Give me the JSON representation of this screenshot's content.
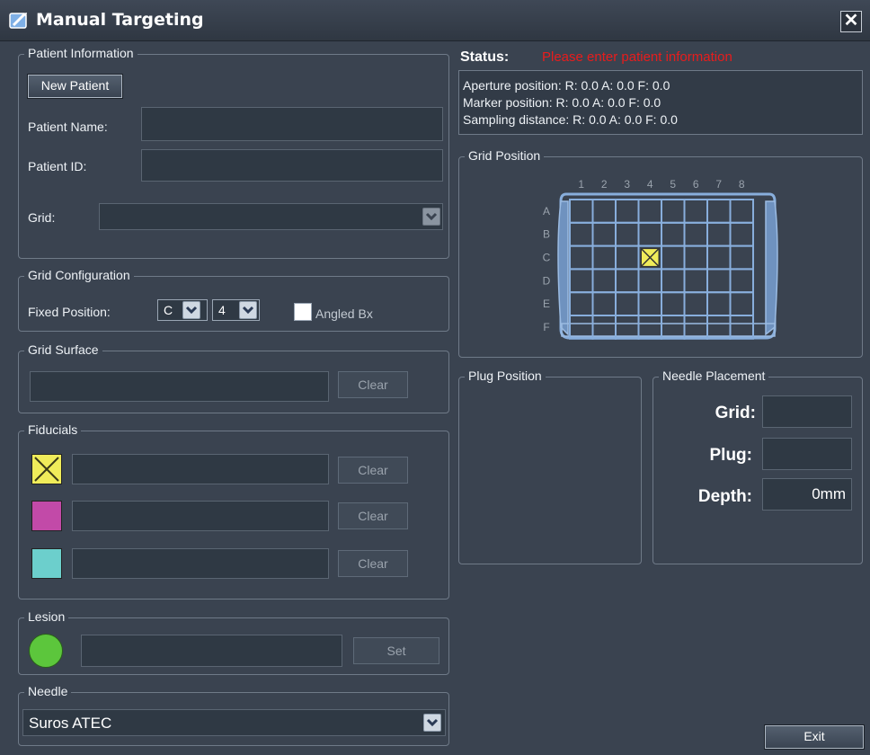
{
  "window": {
    "title": "Manual Targeting",
    "close_glyph": "✕"
  },
  "patient_info": {
    "legend": "Patient Information",
    "new_patient_label": "New Patient",
    "name_label": "Patient Name:",
    "name_value": "",
    "id_label": "Patient ID:",
    "id_value": "",
    "grid_label": "Grid:",
    "grid_value": ""
  },
  "grid_config": {
    "legend": "Grid Configuration",
    "fixed_position_label": "Fixed Position:",
    "row_value": "C",
    "col_value": "4",
    "angled_label": "Angled Bx",
    "angled_checked": false
  },
  "grid_surface": {
    "legend": "Grid Surface",
    "value": "",
    "clear_label": "Clear"
  },
  "fiducials": {
    "legend": "Fiducials",
    "items": [
      {
        "color": "#f0ec5a",
        "value": "",
        "clear_label": "Clear",
        "marked": true
      },
      {
        "color": "#c24aa8",
        "value": "",
        "clear_label": "Clear",
        "marked": false
      },
      {
        "color": "#6ccfcc",
        "value": "",
        "clear_label": "Clear",
        "marked": false
      }
    ]
  },
  "lesion": {
    "legend": "Lesion",
    "color": "#5cc63c",
    "value": "",
    "set_label": "Set"
  },
  "needle": {
    "legend": "Needle",
    "value": "Suros ATEC"
  },
  "status": {
    "label": "Status:",
    "message": "Please enter patient information",
    "lines": [
      "Aperture position: R: 0.0  A: 0.0  F: 0.0",
      "Marker position: R: 0.0  A: 0.0  F: 0.0",
      "Sampling distance: R: 0.0  A: 0.0  F: 0.0"
    ]
  },
  "grid_position": {
    "legend": "Grid Position",
    "columns": [
      "1",
      "2",
      "3",
      "4",
      "5",
      "6",
      "7",
      "8"
    ],
    "rows": [
      "A",
      "B",
      "C",
      "D",
      "E",
      "F"
    ],
    "selected_row": "C",
    "selected_col": "4"
  },
  "plug_position": {
    "legend": "Plug Position"
  },
  "needle_placement": {
    "legend": "Needle Placement",
    "grid_label": "Grid:",
    "grid_value": "",
    "plug_label": "Plug:",
    "plug_value": "",
    "depth_label": "Depth:",
    "depth_value": "0mm"
  },
  "footer": {
    "exit_label": "Exit"
  }
}
